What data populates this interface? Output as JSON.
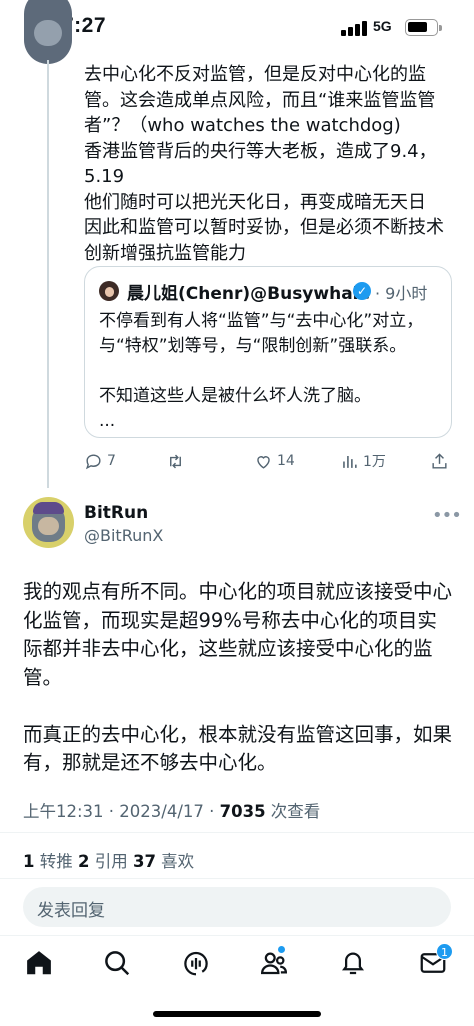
{
  "status_bar": {
    "time": "7:27",
    "network": "5G",
    "icons": [
      "signal-icon",
      "battery-icon"
    ]
  },
  "reply": {
    "text": "去中心化不反对监管，但是反对中心化的监管。这会造成单点风险，而且“谁来监管监管者”？（who watches the watchdog)\n香港监管背后的央行等大老板，造成了9.4，5.19\n他们随时可以把光天化日，再变成暗无天日\n因此和监管可以暂时妥协，但是必须不断技术创新增强抗监管能力",
    "quote": {
      "name": "晨儿姐(Chenr)@Busywhale",
      "time": "· 9小时",
      "body": "不停看到有人将“监管”与“去中心化”对立，与“特权”划等号，与“限制创新”强联系。\n\n不知道这些人是被什么坏人洗了脑。\n..."
    },
    "actions": {
      "comments": "7",
      "retweets": "",
      "likes": "14",
      "views": "1万"
    }
  },
  "post": {
    "display_name": "BitRun",
    "handle": "@BitRunX",
    "text": "我的观点有所不同。中心化的项目就应该接受中心化监管，而现实是超99%号称去中心化的项目实际都并非去中心化，这些就应该接受中心化的监管。\n\n而真正的去中心化，根本就没有监管这回事，如果有，那就是还不够去中心化。",
    "timestamp": "上午12:31 · 2023/4/17 · ",
    "view_count": "7035",
    "view_label": " 次查看",
    "stats": {
      "retweets_count": "1",
      "retweets_label": " 转推 ",
      "quotes_count": "2",
      "quotes_label": " 引用 ",
      "likes_count": "37",
      "likes_label": " 喜欢"
    }
  },
  "reply_box": {
    "placeholder": "发表回复"
  },
  "tab_bar": {
    "tabs": [
      "home-icon",
      "search-icon",
      "spaces-icon",
      "communities-icon",
      "notifications-icon",
      "messages-icon"
    ],
    "messages_badge": "1"
  },
  "colors": {
    "accent": "#1d9bf0",
    "text": "#0f1419",
    "secondary": "#536471"
  }
}
